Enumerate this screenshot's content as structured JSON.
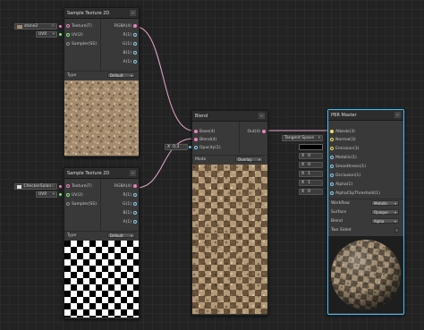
{
  "nodes": {
    "tex1": {
      "title": "Sample Texture 2D",
      "inputs": [
        "Texture(T)",
        "UV(2)",
        "Sampler(SS)"
      ],
      "outputs": [
        "RGBA(4)",
        "R(1)",
        "G(1)",
        "B(1)",
        "A(1)"
      ],
      "type_label": "Type",
      "type_value": "Default",
      "texture_field": "stone2",
      "uv_field": "UV0"
    },
    "tex2": {
      "title": "Sample Texture 2D",
      "inputs": [
        "Texture(T)",
        "UV(2)",
        "Sampler(SS)"
      ],
      "outputs": [
        "RGBA(4)",
        "R(1)",
        "G(1)",
        "B(1)",
        "A(1)"
      ],
      "type_label": "Type",
      "type_value": "Default",
      "texture_field": "CheckerSolan",
      "uv_field": "UV0"
    },
    "blend": {
      "title": "Blend",
      "inputs": [
        "Base(4)",
        "Blend(4)",
        "Opacity(1)"
      ],
      "output": "Out(4)",
      "mode_label": "Mode",
      "mode_value": "Overlay",
      "opacity_x": "X",
      "opacity_val": "0.3"
    },
    "master": {
      "title": "PBR Master",
      "inputs": [
        "Albedo(3)",
        "Normal(3)",
        "Emission(3)",
        "Metallic(1)",
        "Smoothness(1)",
        "Occlusion(1)",
        "Alpha(1)",
        "AlphaClipThreshold(1)"
      ],
      "normal_field": "Tangent Space",
      "value_fields": [
        {
          "x": "X",
          "v": "0"
        },
        {
          "x": "X",
          "v": "0"
        },
        {
          "x": "X",
          "v": "1"
        },
        {
          "x": "X",
          "v": "1"
        },
        {
          "x": "X",
          "v": "0"
        }
      ],
      "props": [
        {
          "label": "Workflow",
          "value": "Metallic"
        },
        {
          "label": "Surface",
          "value": "Opaque"
        },
        {
          "label": "Blend",
          "value": "Alpha"
        }
      ],
      "two_sided_label": "Two Sided"
    }
  },
  "colors": {
    "canvas": "#222222",
    "node": "#393939",
    "selected": "#44c0ff",
    "wire": "#f0a0d0"
  },
  "icons": [
    "chevron-down-icon",
    "port-icon",
    "checkbox-icon"
  ]
}
